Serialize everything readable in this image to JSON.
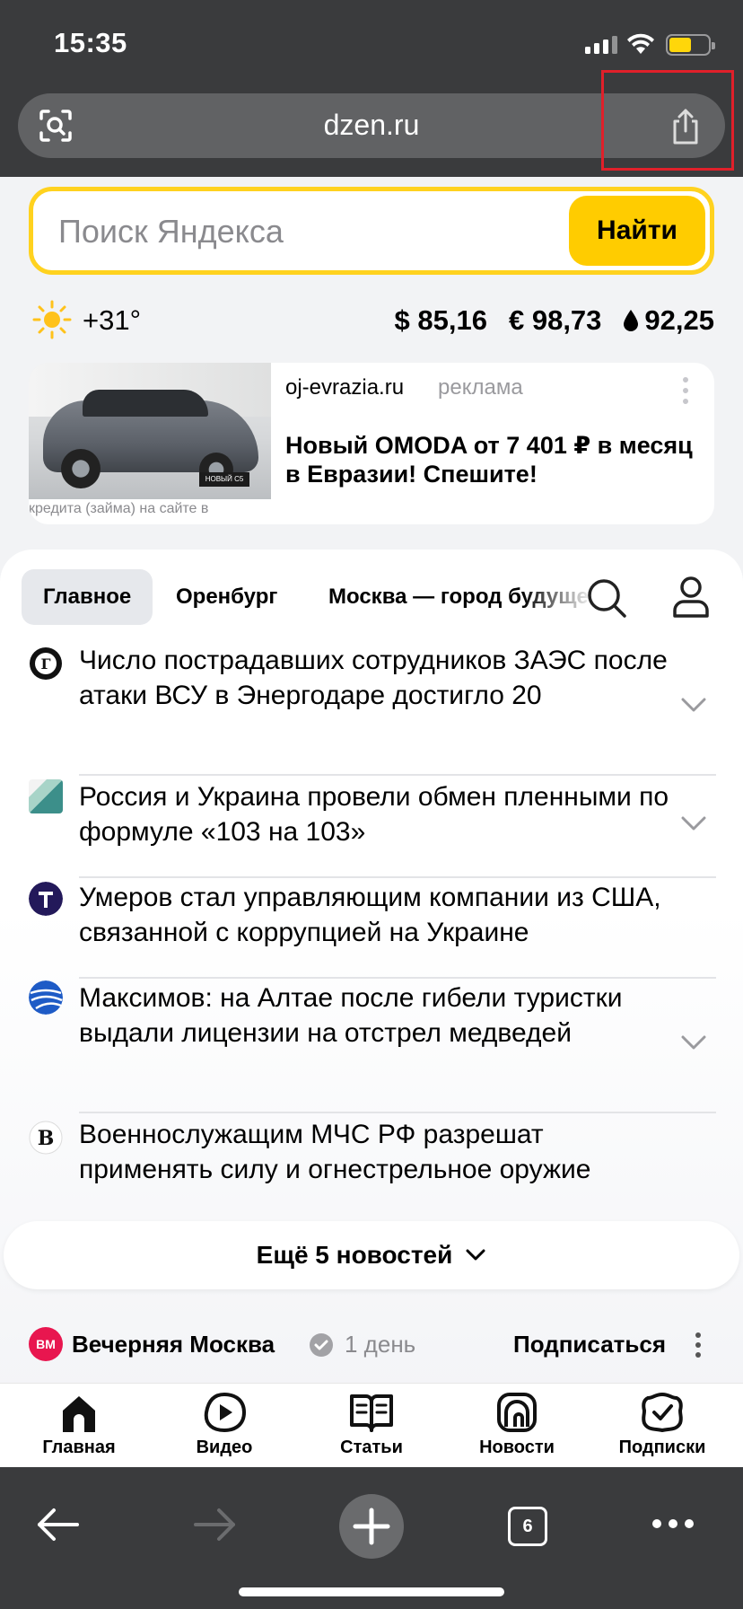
{
  "status_bar": {
    "time": "15:35"
  },
  "browser": {
    "url": "dzen.ru",
    "open_tabs_count": "6"
  },
  "search": {
    "placeholder": "Поиск Яндекса",
    "button_label": "Найти"
  },
  "info": {
    "temperature": "+31°",
    "usd": "$ 85,16",
    "eur": "€ 98,73",
    "oil": "92,25"
  },
  "ad": {
    "domain": "oj-evrazia.ru",
    "label": "реклама",
    "title": "Новый OMODA от 7 401 ₽ в месяц в Евразии! Спешите!",
    "caption": "кредита (займа) на сайте в",
    "plate_text": "НОВЫЙ C5"
  },
  "tabs": [
    "Главное",
    "Оренбург",
    "Москва — город будущего"
  ],
  "news": [
    {
      "text": "Число пострадавших сотрудников ЗАЭС после атаки ВСУ в Энергодаре достигло 20",
      "source_icon": "gazeta-icon",
      "expandable": true
    },
    {
      "text": "Россия и Украина провели обмен пленными по формуле «103 на 103»",
      "source_icon": "izvestia-icon",
      "expandable": true
    },
    {
      "text": "Умеров стал управляющим компании из США, связанной с коррупцией на Украине",
      "source_icon": "tsargrad-icon",
      "expandable": false
    },
    {
      "text": "Максимов: на Алтае после гибели туристки выдали лицензии на отстрел медведей",
      "source_icon": "ria-icon",
      "expandable": true
    },
    {
      "text": "Военнослужащим МЧС РФ разрешат применять силу и огнестрельное оружие",
      "source_icon": "vedomosti-icon",
      "expandable": false
    }
  ],
  "more_news_label": "Ещё 5 новостей",
  "channel": {
    "avatar_text": "ВМ",
    "name": "Вечерняя Москва",
    "time": "1 день",
    "subscribe_label": "Подписаться"
  },
  "bottom_nav": [
    {
      "label": "Главная",
      "icon": "home-icon"
    },
    {
      "label": "Видео",
      "icon": "video-icon"
    },
    {
      "label": "Статьи",
      "icon": "articles-icon"
    },
    {
      "label": "Новости",
      "icon": "news-icon"
    },
    {
      "label": "Подписки",
      "icon": "subscriptions-icon"
    }
  ],
  "colors": {
    "accent_yellow": "#ffcc00",
    "chrome_bg": "#3a3b3d",
    "highlight_red": "#e0202a"
  }
}
